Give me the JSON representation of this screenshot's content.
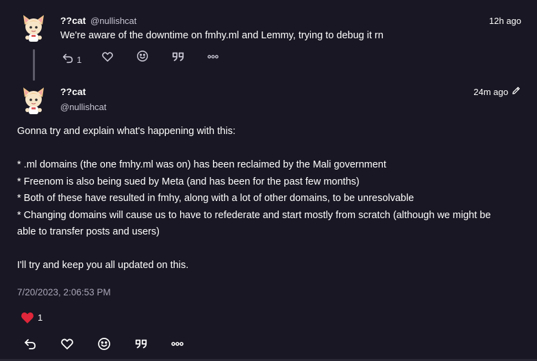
{
  "reply": {
    "display_name": "??cat",
    "handle": "@nullishcat",
    "time": "12h ago",
    "text": "We're aware of the downtime on fmhy.ml and Lemmy, trying to debug it rn",
    "reply_count": "1"
  },
  "main": {
    "display_name": "??cat",
    "handle": "@nullishcat",
    "time": "24m ago",
    "content": [
      "Gonna try and explain what's happening with this:",
      "",
      "* .ml domains (the one fmhy.ml was on) has been reclaimed by the Mali government",
      "* Freenom is also being sued by Meta (and has been for the past few months)",
      "* Both of these have resulted in fmhy, along with a lot of other domains, to be unresolvable",
      "* Changing domains will cause us to have to refederate and start mostly from scratch (although we might be",
      "able to transfer posts and users)",
      "",
      "I'll try and keep you all updated on this."
    ],
    "datetime": "7/20/2023, 2:06:53 PM",
    "reaction_count": "1"
  },
  "icons": [
    "avatar",
    "reply-icon",
    "heart-icon",
    "emoji-icon",
    "quote-icon",
    "more-icon",
    "edit-pencil-icon"
  ],
  "colors": {
    "background": "#191723",
    "muted": "#c9c6d4",
    "heart": "#e0263a"
  }
}
